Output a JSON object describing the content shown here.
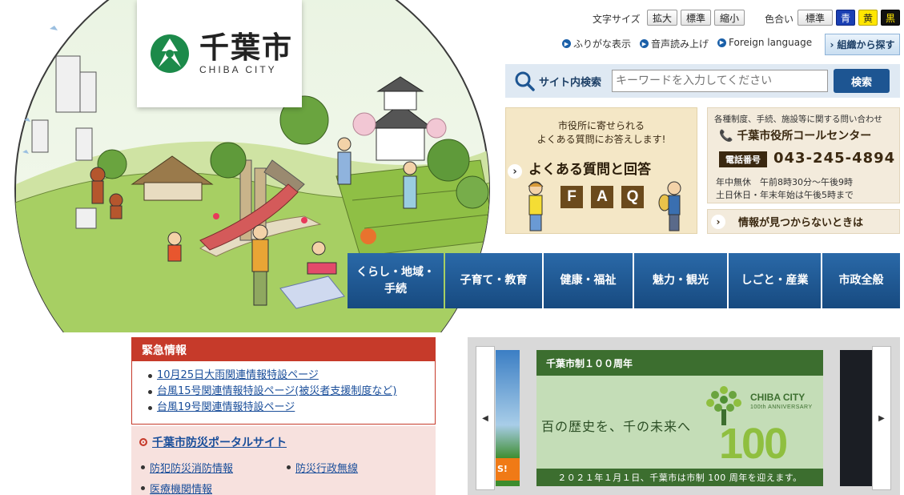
{
  "site": {
    "logo_kanji": "千葉市",
    "logo_roman": "CHIBA CITY"
  },
  "header": {
    "font_size_label": "文字サイズ",
    "font_size_buttons": [
      "拡大",
      "標準",
      "縮小"
    ],
    "color_label": "色合い",
    "color_buttons": [
      "標準",
      "青",
      "黄",
      "黒"
    ],
    "util_links": [
      "ふりがな表示",
      "音声読み上げ",
      "Foreign language"
    ],
    "org_search": "組織から探す"
  },
  "search": {
    "label": "サイト内検索",
    "placeholder": "キーワードを入力してください",
    "button": "検索"
  },
  "faq": {
    "sub_line1": "市役所に寄せられる",
    "sub_line2": "よくある質問にお答えします!",
    "title": "よくある質問と回答",
    "letters": [
      "F",
      "A",
      "Q"
    ]
  },
  "call_center": {
    "intro": "各種制度、手続、施設等に関する問い合わせ",
    "title": "千葉市役所コールセンター",
    "tel_badge": "電話番号",
    "tel_number": "043-245-4894",
    "hours1": "年中無休　午前8時30分～午後9時",
    "hours2": "土日休日・年末年始は午後5時まで"
  },
  "not_found": "情報が見つからないときは",
  "nav": [
    {
      "line1": "くらし・地域・",
      "line2": "手続"
    },
    {
      "line1": "子育て・教育",
      "line2": ""
    },
    {
      "line1": "健康・福祉",
      "line2": ""
    },
    {
      "line1": "魅力・観光",
      "line2": ""
    },
    {
      "line1": "しごと・産業",
      "line2": ""
    },
    {
      "line1": "市政全般",
      "line2": ""
    }
  ],
  "emergency": {
    "heading": "緊急情報",
    "links": [
      "10月25日大雨関連情報特設ページ",
      "台風15号関連情報特設ページ(被災者支援制度など)",
      "台風19号関連情報特設ページ"
    ]
  },
  "disaster": {
    "heading": "千葉市防災ポータルサイト",
    "links": [
      "防犯防災消防情報",
      "防災行政無線",
      "医療機関情報"
    ]
  },
  "carousel": {
    "prev": "◀",
    "next": "▶",
    "slide_title": "千葉市制１００周年",
    "tagline": "百の歴史を、千の未来へ",
    "brand": "CHIBA CITY",
    "anniversary": "100th ANNIVERSARY",
    "number": "100",
    "footer": "２０２１年１月１日、千葉市は市制 100 周年を迎えます。",
    "left_badge": "S!"
  },
  "colors": {
    "nav_blue": "#1d5592",
    "emergency_red": "#c63a2a",
    "anniversary_green": "#3c6e2f"
  }
}
